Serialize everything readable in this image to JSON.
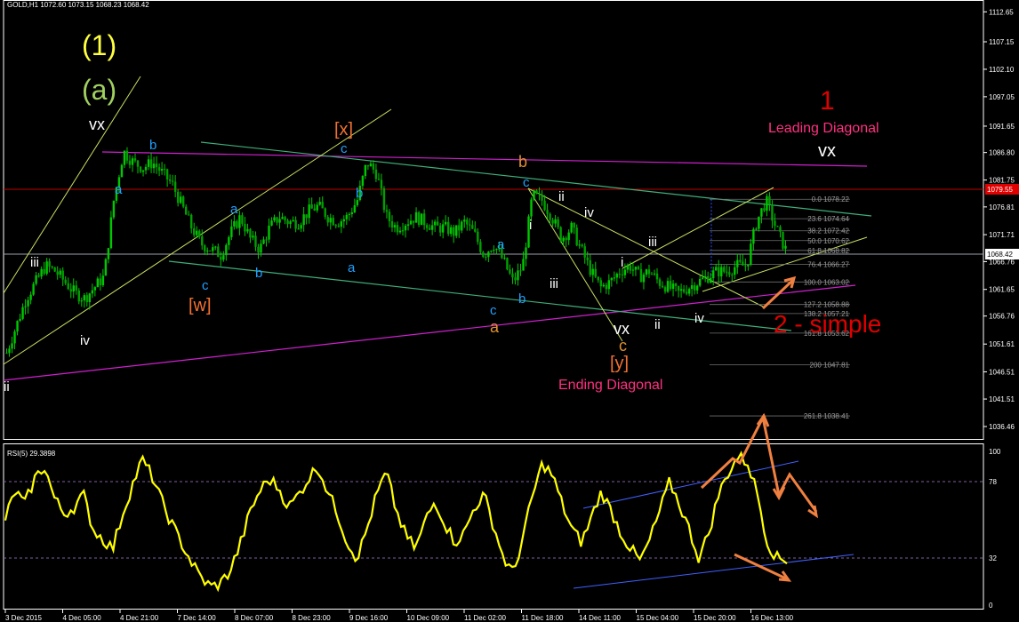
{
  "header": {
    "symbol_line": "GOLD,H1  1072.60 1073.15 1068.23 1068.42",
    "rsi_label": "RSI(5) 29.3898"
  },
  "colors": {
    "background": "#000000",
    "bull_candle": "#00c800",
    "bear_candle": "#00a000",
    "wick": "#00c800",
    "rsi_line": "#ffff00",
    "axis_text": "#ffffff",
    "price_tag_red": "#e00000",
    "price_tag_current": "#ffffff"
  },
  "price_axis": {
    "ticks": [
      "1112.65",
      "1107.15",
      "1102.10",
      "1097.05",
      "1091.65",
      "1086.80",
      "1081.75",
      "1076.81",
      "1071.71",
      "1066.76",
      "1061.65",
      "1056.76",
      "1051.61",
      "1046.51",
      "1041.51",
      "1036.46"
    ],
    "tag_red": "1079.55",
    "tag_current": "1068.42"
  },
  "rsi_axis": {
    "ticks": [
      "100",
      "78",
      "32",
      "0"
    ]
  },
  "time_axis": {
    "labels": [
      "3 Dec 2015",
      "4 Dec 05:00",
      "4 Dec 21:00",
      "7 Dec 14:00",
      "8 Dec 07:00",
      "8 Dec 23:00",
      "9 Dec 16:00",
      "10 Dec 09:00",
      "11 Dec 02:00",
      "11 Dec 18:00",
      "14 Dec 11:00",
      "15 Dec 04:00",
      "15 Dec 20:00",
      "16 Dec 13:00"
    ]
  },
  "fib_levels": [
    {
      "label": "0.0 1078.22",
      "price": 1078.22
    },
    {
      "label": "23.6 1074.64",
      "price": 1074.64
    },
    {
      "label": "38.2 1072.42",
      "price": 1072.42
    },
    {
      "label": "50.0 1070.62",
      "price": 1070.62
    },
    {
      "label": "61.8 1068.82",
      "price": 1068.82
    },
    {
      "label": "76.4 1066.27",
      "price": 1066.27
    },
    {
      "label": "100.0 1063.02",
      "price": 1063.02
    },
    {
      "label": "127.2 1058.88",
      "price": 1058.88
    },
    {
      "label": "138.2 1057.21",
      "price": 1057.21
    },
    {
      "label": "161.8 1053.62",
      "price": 1053.62
    },
    {
      "label": "200 1047.81",
      "price": 1047.81
    },
    {
      "label": "261.8 1038.41",
      "price": 1038.41
    }
  ],
  "annotations": {
    "wave_1": "(1)",
    "wave_a": "(a)",
    "vx_left": "vx",
    "x_bracket": "[x]",
    "w_bracket": "[w]",
    "y_bracket": "[y]",
    "one_red": "1",
    "leading_diagonal": "Leading Diagonal",
    "vx_right": "vx",
    "two_simple": "2 - simple",
    "ending_diagonal": "Ending Diagonal",
    "b_orange": "b",
    "c_orange": "c",
    "a_orange": "a",
    "vx_mid": "vx"
  },
  "chart_data": [
    {
      "type": "candlestick",
      "title": "GOLD,H1",
      "ylim": [
        1034.5,
        1114.5
      ],
      "x": [
        "3 Dec 2015",
        "4 Dec 05:00",
        "4 Dec 21:00",
        "7 Dec 14:00",
        "8 Dec 07:00",
        "8 Dec 23:00",
        "9 Dec 16:00",
        "10 Dec 09:00",
        "11 Dec 02:00",
        "11 Dec 18:00",
        "14 Dec 11:00",
        "15 Dec 04:00",
        "15 Dec 20:00",
        "16 Dec 13:00"
      ],
      "close_path": [
        1050,
        1055,
        1060,
        1063,
        1066,
        1065,
        1063,
        1061,
        1060,
        1062,
        1064,
        1078,
        1087,
        1085,
        1084,
        1085,
        1083,
        1081,
        1077,
        1073,
        1070,
        1069,
        1068,
        1072,
        1075,
        1071,
        1069,
        1073,
        1075,
        1074,
        1074,
        1076,
        1077,
        1075,
        1074,
        1075,
        1078,
        1085,
        1083,
        1075,
        1073,
        1074,
        1075,
        1074,
        1073,
        1073,
        1072,
        1074,
        1072,
        1068,
        1070,
        1067,
        1063,
        1066,
        1079,
        1078,
        1075,
        1071,
        1073,
        1069,
        1065,
        1062,
        1063,
        1065,
        1066,
        1064,
        1065,
        1063,
        1062,
        1061,
        1062,
        1063,
        1064,
        1065,
        1065,
        1066,
        1066,
        1074,
        1078,
        1073,
        1069
      ],
      "last": {
        "open": 1072.6,
        "high": 1073.15,
        "low": 1068.23,
        "close": 1068.42
      }
    },
    {
      "type": "line",
      "title": "RSI(5) 29.3898",
      "ylim": [
        0,
        100
      ],
      "levels": [
        32,
        78
      ],
      "values": [
        55,
        72,
        64,
        80,
        88,
        68,
        58,
        62,
        70,
        48,
        42,
        36,
        58,
        76,
        92,
        82,
        66,
        52,
        40,
        28,
        18,
        12,
        14,
        22,
        38,
        58,
        72,
        80,
        74,
        62,
        70,
        80,
        88,
        72,
        58,
        40,
        30,
        48,
        70,
        84,
        60,
        44,
        36,
        54,
        66,
        52,
        40,
        46,
        62,
        70,
        50,
        30,
        20,
        44,
        70,
        90,
        82,
        64,
        48,
        40,
        56,
        72,
        60,
        46,
        36,
        28,
        42,
        60,
        78,
        64,
        48,
        30,
        46,
        70,
        84,
        94,
        90,
        70,
        40,
        30,
        29
      ]
    }
  ]
}
